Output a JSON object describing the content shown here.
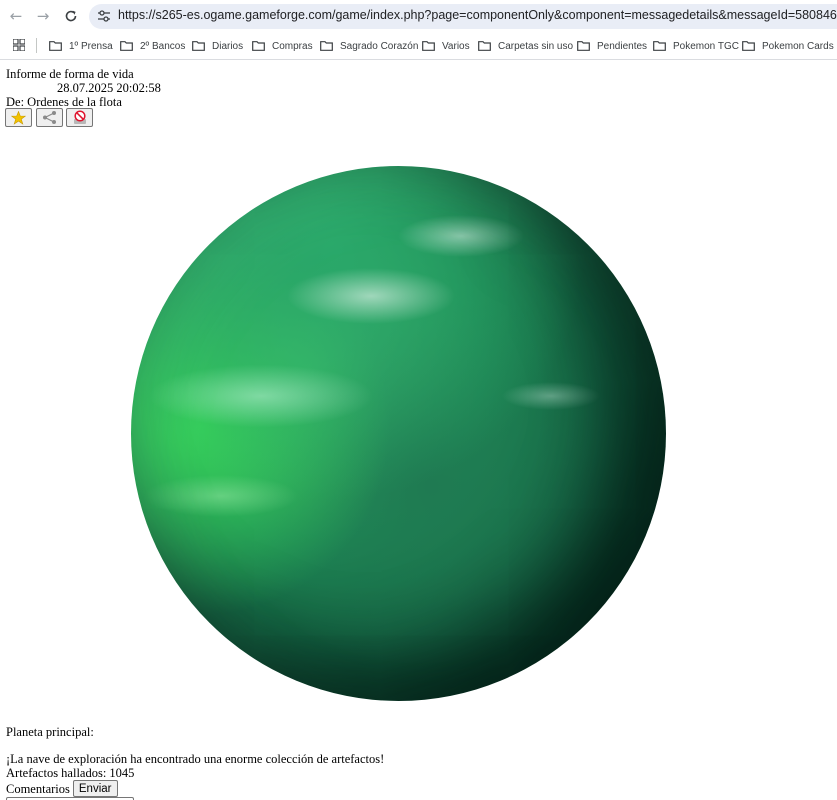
{
  "browser": {
    "url": "https://s265-es.ogame.gameforge.com/game/index.php?page=componentOnly&component=messagedetails&messageId=580846",
    "bookmarks": [
      {
        "label": "1º Prensa"
      },
      {
        "label": "2º Bancos"
      },
      {
        "label": "Diarios"
      },
      {
        "label": "Compras"
      },
      {
        "label": "Sagrado Corazón"
      },
      {
        "label": "Varios"
      },
      {
        "label": "Carpetas sin uso"
      },
      {
        "label": "Pendientes"
      },
      {
        "label": "Pokemon TGC"
      },
      {
        "label": "Pokemon Cards"
      }
    ]
  },
  "message": {
    "title": "Informe de forma de vida",
    "date": "28.07.2025 20:02:58",
    "from": "De: Ordenes de la flota",
    "planet_label": "Planeta principal:",
    "result": "¡La nave de exploración ha encontrado una enorme colección de artefactos!",
    "artifacts": "Artefactos hallados: 1045",
    "comments_label": "Comentarios",
    "send_label": "Enviar"
  },
  "colors": {
    "omnibox_bg": "#e9edf6",
    "star": "#f2c200",
    "block": "#e0142e"
  }
}
